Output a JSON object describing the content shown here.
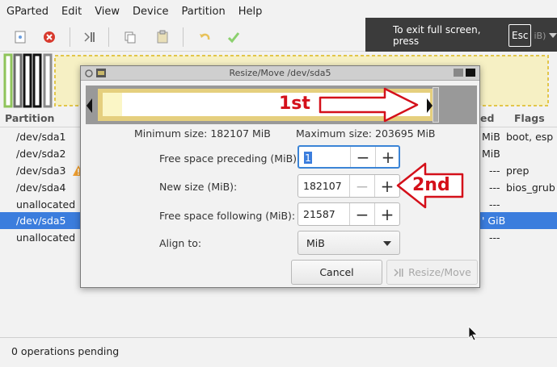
{
  "menubar": {
    "items": [
      "GParted",
      "Edit",
      "View",
      "Device",
      "Partition",
      "Help"
    ]
  },
  "fullscreen_notice": {
    "text": "To exit full screen, press",
    "key": "Esc",
    "ghost_text": "iB)"
  },
  "table": {
    "headers": {
      "partition": "Partition",
      "used": "ed",
      "flags": "Flags"
    },
    "rows": [
      {
        "partition": "/dev/sda1",
        "used": "MiB",
        "flags": "boot, esp",
        "warning": false,
        "selected": false
      },
      {
        "partition": "/dev/sda2",
        "used": "MiB",
        "flags": "",
        "warning": false,
        "selected": false
      },
      {
        "partition": "/dev/sda3",
        "used": "---",
        "flags": "prep",
        "warning": true,
        "selected": false
      },
      {
        "partition": "/dev/sda4",
        "used": "---",
        "flags": "bios_grub",
        "warning": false,
        "selected": false
      },
      {
        "partition": "unallocated",
        "used": "---",
        "flags": "",
        "warning": false,
        "selected": false
      },
      {
        "partition": "/dev/sda5",
        "used": "' GiB",
        "flags": "",
        "warning": false,
        "selected": true
      },
      {
        "partition": "unallocated",
        "used": "---",
        "flags": "",
        "warning": false,
        "selected": false
      }
    ]
  },
  "status": {
    "text": "0 operations pending"
  },
  "dialog": {
    "title": "Resize/Move /dev/sda5",
    "min_size": "Minimum size: 182107 MiB",
    "max_size": "Maximum size: 203695 MiB",
    "fields": {
      "free_preceding": {
        "label": "Free space preceding (MiB):",
        "value": "1"
      },
      "new_size": {
        "label": "New size (MiB):",
        "value": "182107"
      },
      "free_following": {
        "label": "Free space following (MiB):",
        "value": "21587"
      }
    },
    "align": {
      "label": "Align to:",
      "value": "MiB"
    },
    "buttons": {
      "cancel": "Cancel",
      "resize_move": "Resize/Move"
    }
  },
  "annotations": {
    "first": "1st",
    "second": "2nd",
    "color": "#d4101a"
  },
  "colors": {
    "selection": "#3b7ddd",
    "partition_border": "#e5cf7e",
    "focus": "#3b84d6"
  }
}
